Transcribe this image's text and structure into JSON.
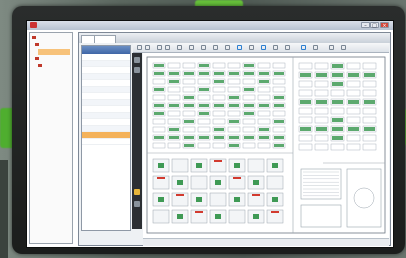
{
  "window": {
    "title": "",
    "min": "–",
    "max": "□",
    "close": "×"
  },
  "tree": {
    "items": [
      {
        "label": ""
      },
      {
        "label": ""
      },
      {
        "label": ""
      },
      {
        "label": ""
      },
      {
        "label": ""
      }
    ]
  },
  "app": {
    "tabs": [
      {
        "label": ""
      },
      {
        "label": ""
      }
    ],
    "floor_list": {
      "header": "",
      "rows": [
        {
          "label": ""
        },
        {
          "label": ""
        },
        {
          "label": ""
        },
        {
          "label": ""
        },
        {
          "label": ""
        },
        {
          "label": ""
        },
        {
          "label": ""
        },
        {
          "label": ""
        },
        {
          "label": ""
        },
        {
          "label": ""
        },
        {
          "label": ""
        },
        {
          "label": ""
        },
        {
          "label": ""
        },
        {
          "label": ""
        }
      ],
      "selected_index": 12
    },
    "status": ""
  },
  "colors": {
    "accent_green": "#66c03a",
    "selection_orange": "#f4b25a",
    "seat_green": "#3f9a55",
    "marker_red": "#d23a2f",
    "plan_line": "#9aa4ae"
  }
}
